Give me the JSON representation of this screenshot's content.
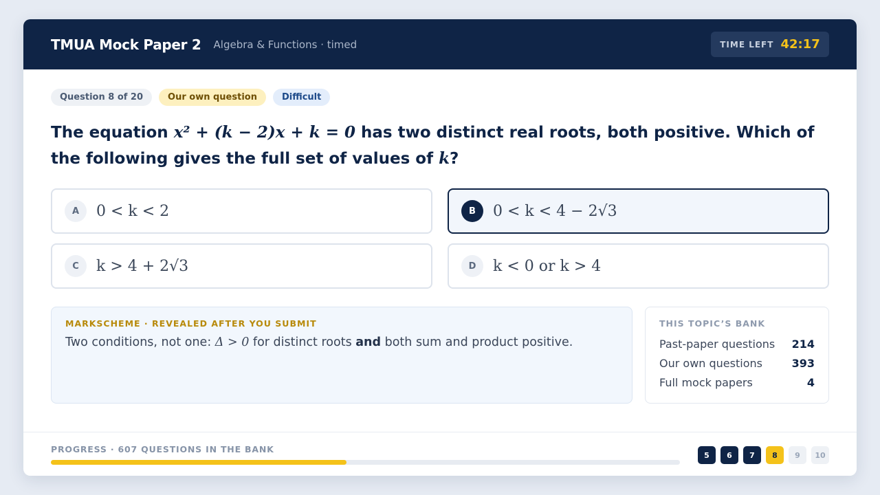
{
  "header": {
    "title": "TMUA Mock Paper 2",
    "subtitle": "Algebra & Functions · timed",
    "timer_label": "TIME LEFT",
    "timer_value": "42:17"
  },
  "badges": {
    "question_number": "Question 8 of 20",
    "source": "Our own question",
    "difficulty": "Difficult"
  },
  "question": {
    "t1": "The equation ",
    "m1": "x² + (k − 2)x + k = 0",
    "t2": " has two distinct real roots, both positive. Which of the following gives the full set of values of ",
    "m2": "k",
    "t3": "?"
  },
  "options": [
    {
      "letter": "A",
      "text": "0 < k < 2",
      "selected": false
    },
    {
      "letter": "B",
      "text": "0 < k < 4 − 2√3",
      "selected": true
    },
    {
      "letter": "C",
      "text": "k > 4 + 2√3",
      "selected": false
    },
    {
      "letter": "D",
      "text": "k < 0 or k > 4",
      "selected": false
    }
  ],
  "markscheme": {
    "label": "MARKSCHEME · REVEALED AFTER YOU SUBMIT",
    "t1": "Two conditions, not one: ",
    "m1": "Δ > 0",
    "t2": " for distinct roots ",
    "bold": "and",
    "t3": " both sum and product positive."
  },
  "bank": {
    "title": "THIS TOPIC’S BANK",
    "rows": [
      {
        "label": "Past-paper questions",
        "value": "214"
      },
      {
        "label": "Our own questions",
        "value": "393"
      },
      {
        "label": "Full mock papers",
        "value": "4"
      }
    ]
  },
  "footer": {
    "progress_label": "PROGRESS · 607 QUESTIONS IN THE BANK",
    "progress_fraction": 0.47,
    "pages": [
      {
        "n": "5",
        "state": "done"
      },
      {
        "n": "6",
        "state": "done"
      },
      {
        "n": "7",
        "state": "done"
      },
      {
        "n": "8",
        "state": "current"
      },
      {
        "n": "9",
        "state": "todo"
      },
      {
        "n": "10",
        "state": "todo"
      }
    ]
  },
  "colors": {
    "navy": "#0f2446",
    "accent_yellow": "#f4c21a",
    "markscheme_gold": "#b88a0a"
  }
}
